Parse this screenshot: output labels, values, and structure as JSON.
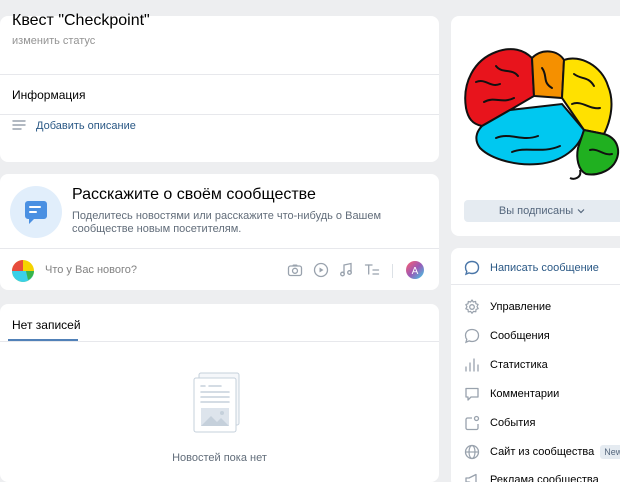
{
  "header": {
    "title": "Квест \"Checkpoint\"",
    "status": "изменить статус",
    "info_label": "Информация",
    "add_description": "Добавить описание"
  },
  "promo": {
    "title": "Расскажите о своём сообществе",
    "description": "Поделитесь новостями или расскажите что-нибудь о Вашем сообществе новым посетителям.",
    "post_placeholder": "Что у Вас нового?",
    "tools": [
      "camera-icon",
      "video-icon",
      "music-icon",
      "text-format-icon",
      "author-avatar"
    ],
    "author_initial": "А"
  },
  "feed": {
    "tab_label": "Нет записей",
    "empty_text": "Новостей пока нет"
  },
  "sidebar": {
    "subscribed_label": "Вы подписаны",
    "menu": [
      {
        "label": "Написать сообщение",
        "icon": "message-bubble-icon",
        "primary": true
      },
      {
        "label": "Управление",
        "icon": "gear-icon"
      },
      {
        "label": "Сообщения",
        "icon": "chat-bubble-icon"
      },
      {
        "label": "Статистика",
        "icon": "stats-icon"
      },
      {
        "label": "Комментарии",
        "icon": "comments-icon"
      },
      {
        "label": "События",
        "icon": "events-icon"
      },
      {
        "label": "Сайт из сообщества",
        "icon": "globe-icon",
        "badge": "New"
      },
      {
        "label": "Реклама сообщества",
        "icon": "megaphone-icon"
      }
    ]
  },
  "colors": {
    "accent": "#2a5885",
    "button_bg": "#e5ebf1",
    "page_bg": "#edeef0",
    "icon_blue": "#4bb34b"
  }
}
